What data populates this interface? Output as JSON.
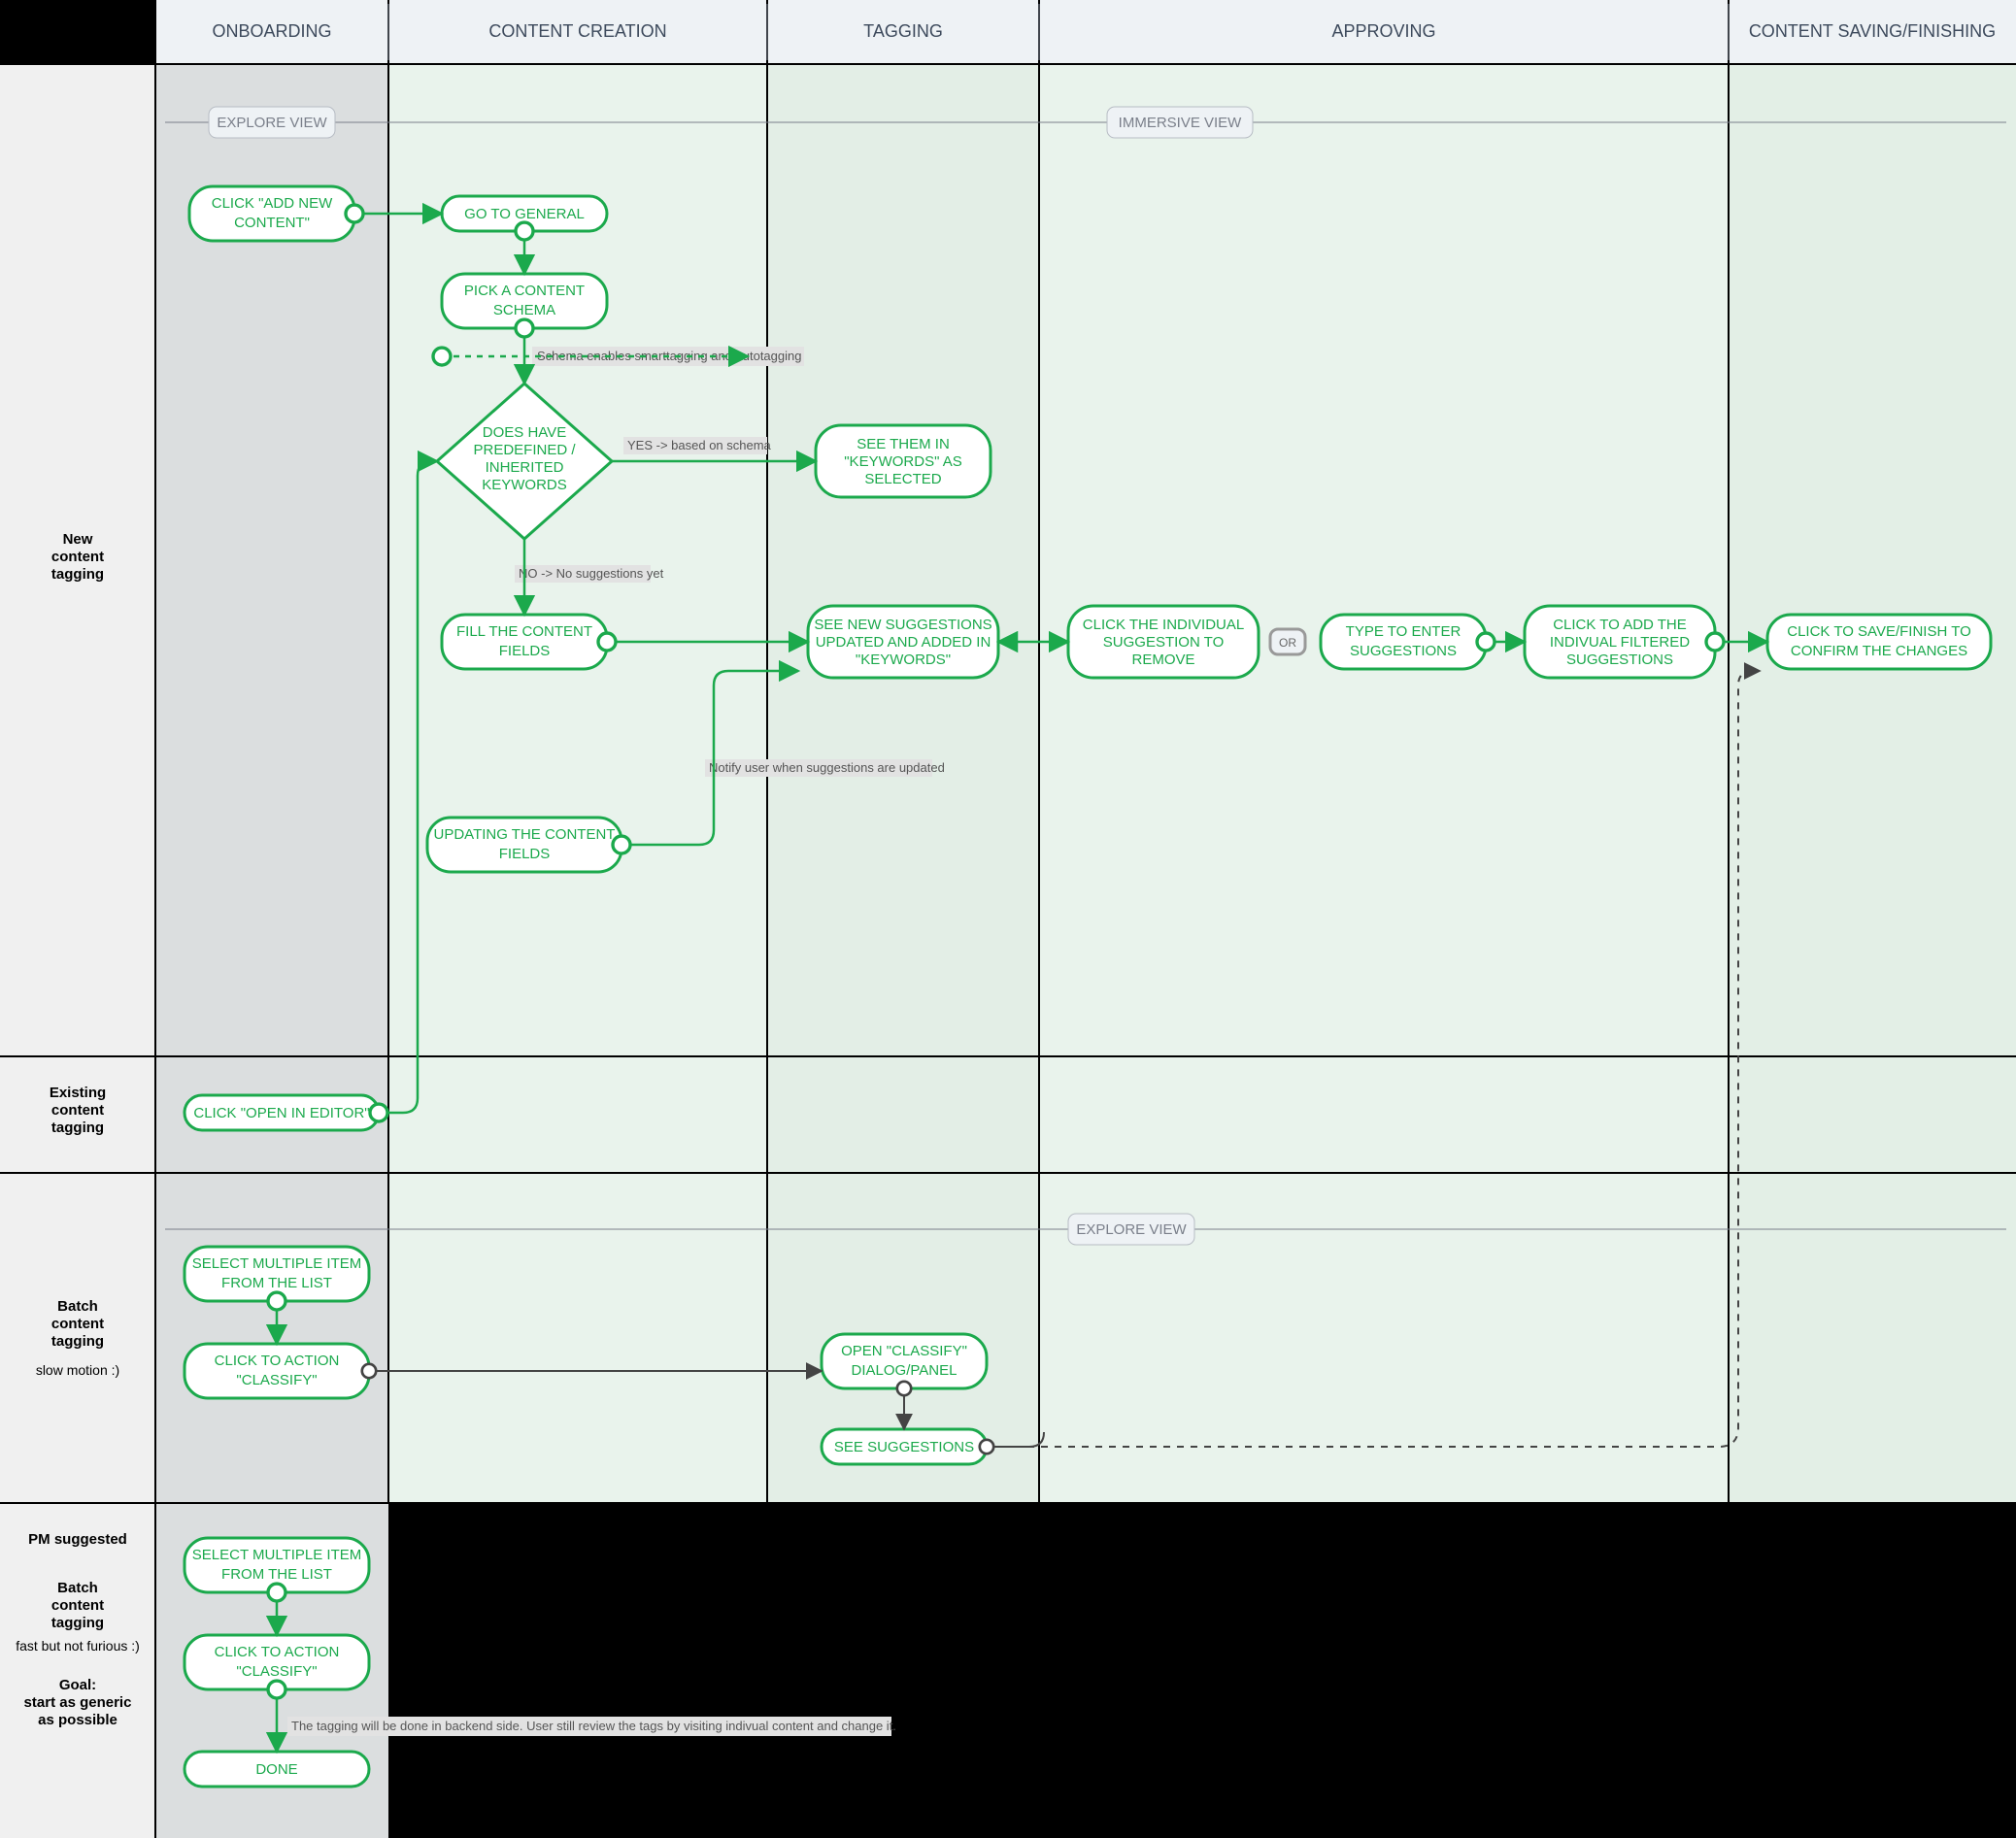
{
  "columns": {
    "c1": "ONBOARDING",
    "c2": "CONTENT CREATION",
    "c3": "TAGGING",
    "c4": "APPROVING",
    "c5": "CONTENT SAVING/FINISHING"
  },
  "rows": {
    "r1a": "New",
    "r1b": "content",
    "r1c": "tagging",
    "r2a": "Existing",
    "r2b": "content",
    "r2c": "tagging",
    "r3a": "Batch",
    "r3b": "content",
    "r3c": "tagging",
    "r3d": "slow motion :)",
    "r4a": "PM suggested",
    "r4b": "Batch",
    "r4c": "content",
    "r4d": "tagging",
    "r4e": "fast but not furious :)",
    "r4f": "Goal:",
    "r4g": "start as generic",
    "r4h": "as possible"
  },
  "views": {
    "explore1": "EXPLORE VIEW",
    "immersive": "IMMERSIVE VIEW",
    "explore2": "EXPLORE VIEW"
  },
  "nodes": {
    "addNew1": "CLICK \"ADD NEW",
    "addNew2": "CONTENT\"",
    "goGeneral": "GO TO GENERAL",
    "pickSchema1": "PICK A CONTENT",
    "pickSchema2": "SCHEMA",
    "decision1": "DOES HAVE",
    "decision2": "PREDEFINED /",
    "decision3": "INHERITED",
    "decision4": "KEYWORDS",
    "seeKw1": "SEE THEM IN",
    "seeKw2": "\"KEYWORDS\" AS",
    "seeKw3": "SELECTED",
    "fill1": "FILL THE CONTENT",
    "fill2": "FIELDS",
    "update1": "UPDATING THE CONTENT",
    "update2": "FIELDS",
    "seeSugg1": "SEE NEW SUGGESTIONS",
    "seeSugg2": "UPDATED AND ADDED IN",
    "seeSugg3": "\"KEYWORDS\"",
    "clickInd1": "CLICK THE INDIVIDUAL",
    "clickInd2": "SUGGESTION TO",
    "clickInd3": "REMOVE",
    "or": "OR",
    "typeEnter1": "TYPE TO ENTER",
    "typeEnter2": "SUGGESTIONS",
    "addFilt1": "CLICK TO ADD THE",
    "addFilt2": "INDIVUAL FILTERED",
    "addFilt3": "SUGGESTIONS",
    "save1": "CLICK TO SAVE/FINISH TO",
    "save2": "CONFIRM THE CHANGES",
    "openEditor": "CLICK \"OPEN IN EDITOR\"",
    "selMulti1a": "SELECT MULTIPLE ITEM",
    "selMulti1b": "FROM THE LIST",
    "classify1a": "CLICK TO ACTION",
    "classify1b": "\"CLASSIFY\"",
    "openDlg1": "OPEN \"CLASSIFY\"",
    "openDlg2": "DIALOG/PANEL",
    "seeSuggBatch": "SEE SUGGESTIONS",
    "selMulti2a": "SELECT MULTIPLE ITEM",
    "selMulti2b": "FROM THE LIST",
    "classify2a": "CLICK TO ACTION",
    "classify2b": "\"CLASSIFY\"",
    "done": "DONE"
  },
  "notes": {
    "schemaNote": "Schema enables smarttagging and autotagging",
    "yesEdge": "YES -> based on schema",
    "noEdge": "NO -> No suggestions yet",
    "notifyNote": "Notify user when suggestions are updated",
    "backendNote": "The tagging will be done in backend side.  User still review the tags by visiting indivual content and change it."
  }
}
